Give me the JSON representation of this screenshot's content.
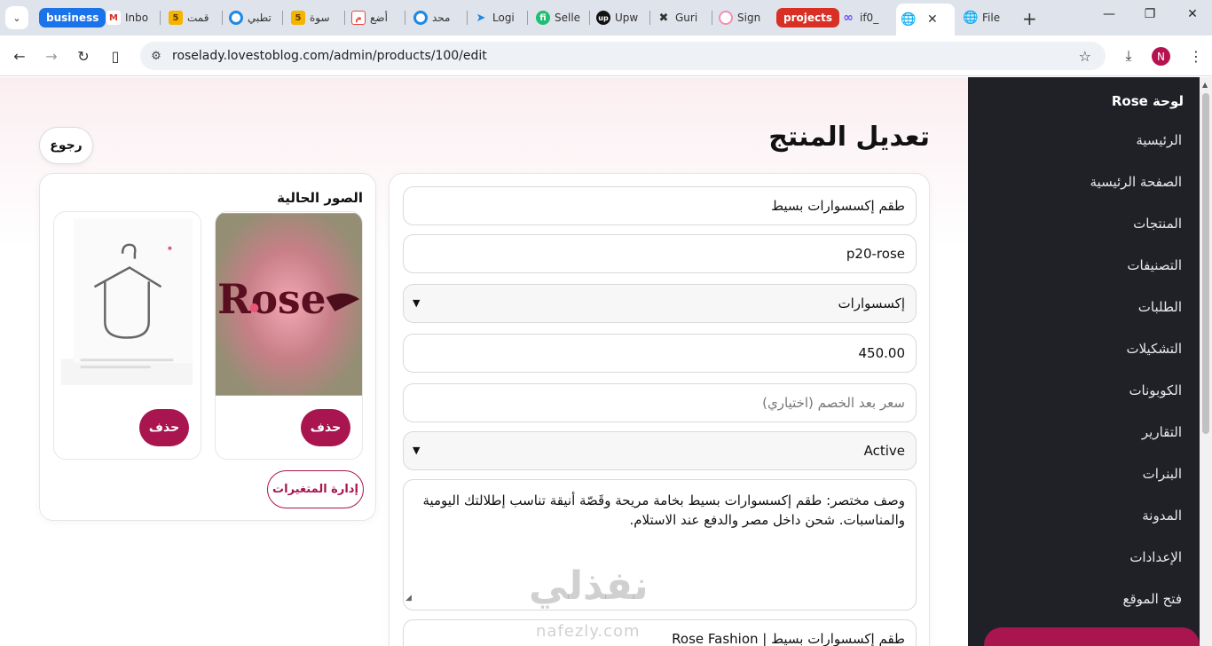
{
  "browser": {
    "tabs": [
      {
        "label": "business",
        "type": "group",
        "color": "#1a73e8"
      },
      {
        "label": "Inbo",
        "icon": "gmail-icon"
      },
      {
        "label": "قمت",
        "icon": "five-icon"
      },
      {
        "label": "تطبي",
        "icon": "circle-icon"
      },
      {
        "label": "سوة",
        "icon": "five-icon"
      },
      {
        "label": "أضع",
        "icon": "mostaql-icon"
      },
      {
        "label": "محد",
        "icon": "circle-icon"
      },
      {
        "label": "Logi",
        "icon": "arrow-icon"
      },
      {
        "label": "Selle",
        "icon": "fiverr-icon"
      },
      {
        "label": "Upw",
        "icon": "upwork-icon"
      },
      {
        "label": "Guri",
        "icon": "guru-icon"
      },
      {
        "label": "Sign",
        "icon": "ring-icon"
      },
      {
        "label": "projects",
        "type": "group",
        "color": "#d93025"
      },
      {
        "label": "if0_",
        "icon": "infinity-icon"
      },
      {
        "label": "",
        "icon": "globe-icon",
        "active": true
      },
      {
        "label": "File",
        "icon": "globe-icon"
      }
    ],
    "url": "roselady.lovestoblog.com/admin/products/100/edit",
    "profile_initial": "N"
  },
  "sidebar": {
    "brand": "لوحة Rose",
    "items": [
      "الرئيسية",
      "الصفحة الرئيسية",
      "المنتجات",
      "التصنيفات",
      "الطلبات",
      "التشكيلات",
      "الكوبونات",
      "التقارير",
      "البنرات",
      "المدونة",
      "الإعدادات",
      "فتح الموقع"
    ]
  },
  "main": {
    "title": "تعديل المنتج",
    "back_label": "رجوع",
    "form": {
      "name": "طقم إكسسوارات بسيط",
      "sku": "p20-rose",
      "category": "إكسسوارات",
      "price": "450.00",
      "sale_price_placeholder": "سعر بعد الخصم (اختياري)",
      "status": "Active",
      "description": "وصف مختصر: طقم إكسسوارات بسيط بخامة مريحة وقَصّة أنيقة تناسب إطلالتك اليومية والمناسبات. شحن داخل مصر والدفع عند الاستلام.",
      "meta_title": "طقم إكسسوارات بسيط | Rose Fashion"
    },
    "images": {
      "title": "الصور الحالية",
      "delete_label": "حذف",
      "logo_text": "Rose",
      "variants_label": "إدارة المتغيرات"
    }
  },
  "watermark": {
    "text": "نفذلي",
    "sub": "nafezly.com"
  },
  "colors": {
    "accent": "#a8154f",
    "sidebar_bg": "#1f2127"
  }
}
